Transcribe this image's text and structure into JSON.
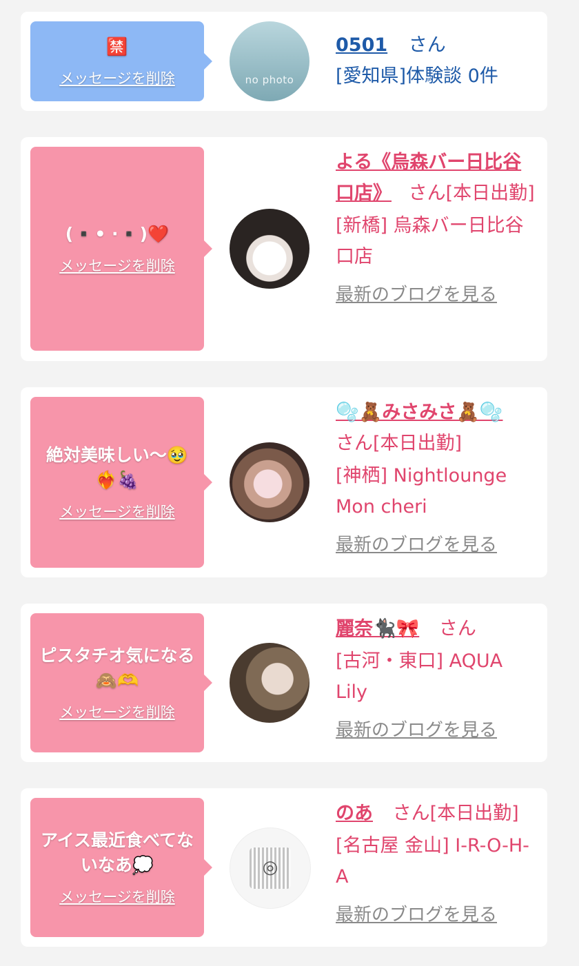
{
  "cards": [
    {
      "message": "🈲",
      "delete_label": "メッセージを削除",
      "avatar_caption": "no photo",
      "name": "0501",
      "suffix": "さん",
      "area": "[愛知県]体験談 0件"
    },
    {
      "message": "(▪️• ·▪️)❤️",
      "delete_label": "メッセージを削除",
      "name": "よる《烏森バー日比谷口店》",
      "suffix": "さん[本日出勤]",
      "area": "[新橋] 烏森バー日比谷口店",
      "blog_label": "最新のブログを見る"
    },
    {
      "message": "絶対美味しい〜🥹❤️‍🔥🍇",
      "delete_label": "メッセージを削除",
      "name": "🫧🧸みさみさ🧸🫧",
      "suffix": "さん[本日出勤]",
      "area": "[神栖] Nightlounge Mon cheri",
      "blog_label": "最新のブログを見る"
    },
    {
      "message": "ピスタチオ気になる🙈🫶",
      "delete_label": "メッセージを削除",
      "name": "麗奈🐈‍⬛🎀",
      "suffix": "さん",
      "area": "[古河・東口] AQUA Lily",
      "blog_label": "最新のブログを見る"
    },
    {
      "message": "アイス最近食べてないなあ💭",
      "delete_label": "メッセージを削除",
      "name": "のあ",
      "suffix": "さん[本日出勤]",
      "area": "[名古屋 金山] I-R-O-H-A",
      "blog_label": "最新のブログを見る"
    }
  ],
  "colors": {
    "bubble_blue": "#8db8f5",
    "bubble_pink": "#f795aa",
    "text_blue": "#1e5aa8",
    "text_pink": "#e0456d",
    "blog_gray": "#8a8a8a"
  }
}
